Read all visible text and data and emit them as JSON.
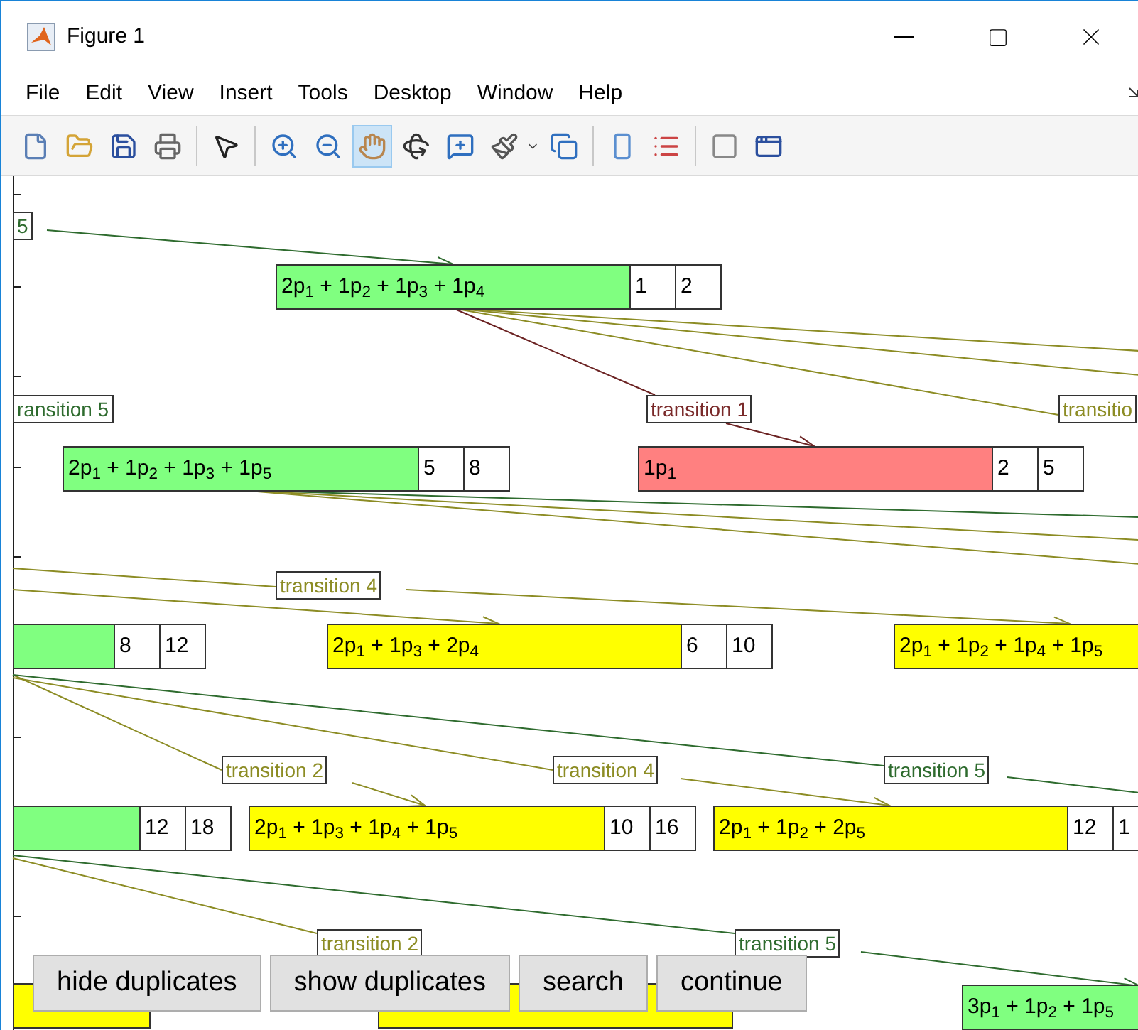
{
  "window": {
    "title": "Figure 1"
  },
  "menu": [
    "File",
    "Edit",
    "View",
    "Insert",
    "Tools",
    "Desktop",
    "Window",
    "Help"
  ],
  "toolbar": [
    {
      "selected": false
    },
    {
      "selected": false
    },
    {
      "selected": false
    },
    {
      "selected": false
    },
    {
      "selected": false
    },
    {
      "selected": false
    },
    {
      "selected": false
    },
    {
      "selected": true
    },
    {
      "selected": false
    },
    {
      "selected": false
    },
    {
      "selected": false
    },
    {
      "selected": false
    },
    {
      "selected": false
    },
    {
      "selected": false
    },
    {
      "selected": false
    },
    {
      "selected": false
    }
  ],
  "nodes": [
    {
      "label": "2p$_{1}$ + 1p$_{2}$ + 1p$_{3}$ + 1p$_{4}$",
      "color": "#80ff80",
      "counts": [
        "1",
        "2"
      ]
    },
    {
      "label": "2p$_{1}$ + 1p$_{2}$ + 1p$_{3}$ + 1p$_{5}$",
      "color": "#80ff80",
      "counts": [
        "5",
        "8"
      ]
    },
    {
      "label": "1p$_{1}$",
      "color": "#ff8080",
      "counts": [
        "2",
        "5"
      ]
    },
    {
      "color": "#80ff80",
      "counts": [
        "8",
        "12"
      ]
    },
    {
      "label": "2p$_{1}$ + 1p$_{3}$ + 2p$_{4}$",
      "color": "#ffff00",
      "counts": [
        "6",
        "10"
      ]
    },
    {
      "label": "2p$_{1}$ + 1p$_{2}$ + 1p$_{4}$ + 1p$_{5}$",
      "color": "#ffff00"
    },
    {
      "color": "#80ff80",
      "counts": [
        "12",
        "18"
      ]
    },
    {
      "label": "2p$_{1}$ + 1p$_{3}$ + 1p$_{4}$ + 1p$_{5}$",
      "color": "#ffff00",
      "counts": [
        "10",
        "16"
      ]
    },
    {
      "label": "2p$_{1}$ + 1p$_{2}$ + 2p$_{5}$",
      "color": "#ffff00",
      "counts": [
        "12",
        "1"
      ]
    },
    {
      "color": "#ffff00"
    },
    {
      "color": "#ffff00"
    },
    {
      "label": "3p$_{1}$ + 1p$_{2}$ + 1p$_{5}$",
      "color": "#80ff80"
    }
  ],
  "transition_labels": [
    {
      "text": "5",
      "color": "#2e6b2e"
    },
    {
      "text": "ransition 5",
      "color": "#2e6b2e"
    },
    {
      "text": "transition 1",
      "color": "#7a2a2a"
    },
    {
      "text": "transitio",
      "color": "#8c8c24"
    },
    {
      "text": "transition 4",
      "color": "#8c8c24"
    },
    {
      "text": "transition 2",
      "color": "#8c8c24"
    },
    {
      "text": "transition 4",
      "color": "#8c8c24"
    },
    {
      "text": "transition 5",
      "color": "#2e6b2e"
    },
    {
      "text": "transition 2",
      "color": "#8c8c24"
    },
    {
      "text": "transition 5",
      "color": "#2e6b2e"
    }
  ],
  "buttons": [
    "hide duplicates",
    "show duplicates",
    "search",
    "continue"
  ]
}
